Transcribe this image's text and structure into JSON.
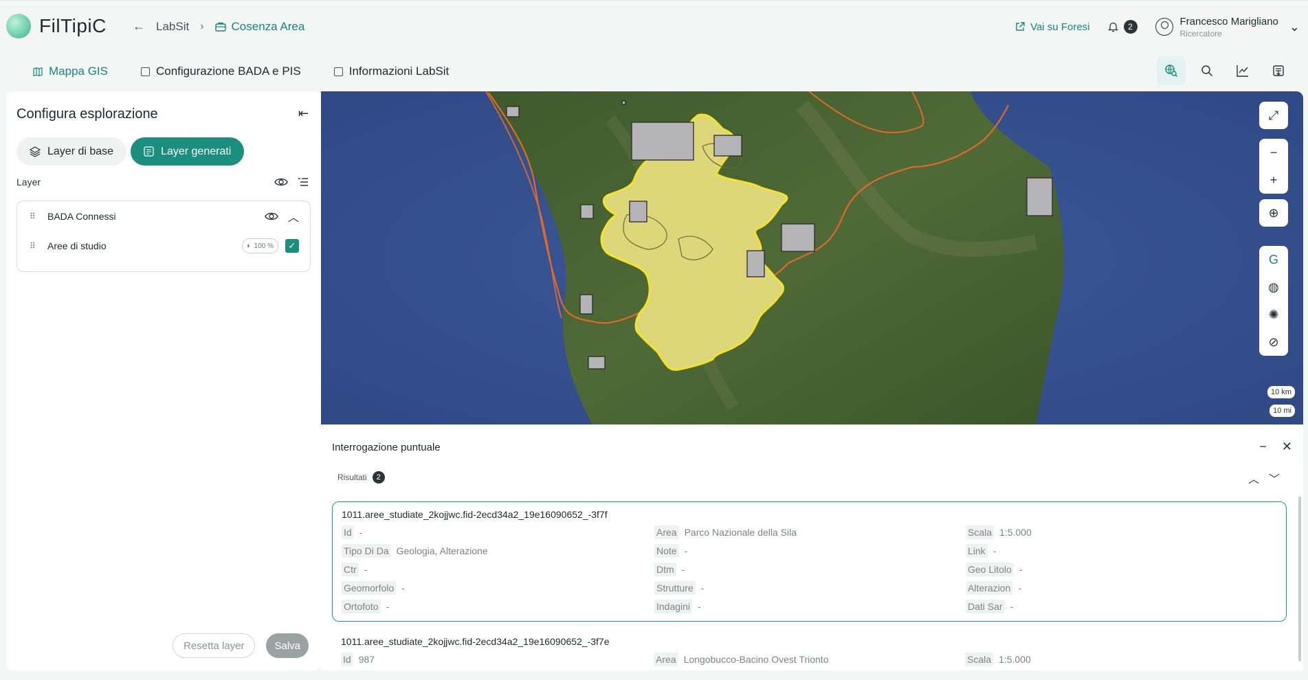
{
  "app": {
    "name": "FilTipiC"
  },
  "breadcrumb": {
    "parent": "LabSit",
    "current": "Cosenza Area"
  },
  "header": {
    "external_link": "Vai su Foresi",
    "notifications_count": "2",
    "user_name": "Francesco Marigliano",
    "user_role": "Ricercatore"
  },
  "tabs": [
    {
      "label": "Mappa GIS"
    },
    {
      "label": "Configurazione BADA e PIS"
    },
    {
      "label": "Informazioni LabSit"
    }
  ],
  "sidebar": {
    "title": "Configura esplorazione",
    "segment_base": "Layer di base",
    "segment_generated": "Layer generati",
    "layer_heading": "Layer",
    "group_name": "BADA Connessi",
    "layer_name": "Aree di studio",
    "layer_opacity": "100 %",
    "reset_label": "Resetta layer",
    "save_label": "Salva"
  },
  "map": {
    "scale_km": "10 km",
    "scale_mi": "10 mi"
  },
  "query_panel": {
    "title": "Interrogazione puntuale",
    "results_label": "Risultati",
    "results_count": "2",
    "results": [
      {
        "id": "1011.aree_studiate_2kojjwc.fid-2ecd34a2_19e16090652_-3f7f",
        "fields": [
          {
            "k": "Id",
            "v": "-"
          },
          {
            "k": "Area",
            "v": "Parco Nazionale della Sila"
          },
          {
            "k": "Scala",
            "v": "1:5.000"
          },
          {
            "k": "Tipo Di Da",
            "v": "Geologia, Alterazione"
          },
          {
            "k": "Note",
            "v": "-"
          },
          {
            "k": "Link",
            "v": "-"
          },
          {
            "k": "Ctr",
            "v": "-"
          },
          {
            "k": "Dtm",
            "v": "-"
          },
          {
            "k": "Geo Litolo",
            "v": "-"
          },
          {
            "k": "Geomorfolo",
            "v": "-"
          },
          {
            "k": "Strutture",
            "v": "-"
          },
          {
            "k": "Alterazion",
            "v": "-"
          },
          {
            "k": "Ortofoto",
            "v": "-"
          },
          {
            "k": "Indagini",
            "v": "-"
          },
          {
            "k": "Dati Sar",
            "v": "-"
          }
        ]
      },
      {
        "id": "1011.aree_studiate_2kojjwc.fid-2ecd34a2_19e16090652_-3f7e",
        "fields": [
          {
            "k": "Id",
            "v": "987"
          },
          {
            "k": "Area",
            "v": "Longobucco-Bacino Ovest Trionto"
          },
          {
            "k": "Scala",
            "v": "1:5.000"
          }
        ]
      }
    ]
  },
  "colors": {
    "accent": "#1a8f7f",
    "study_area_fill": "#ddd77a",
    "study_area_stroke": "#f2e42a",
    "boundary": "#e06a2a"
  }
}
